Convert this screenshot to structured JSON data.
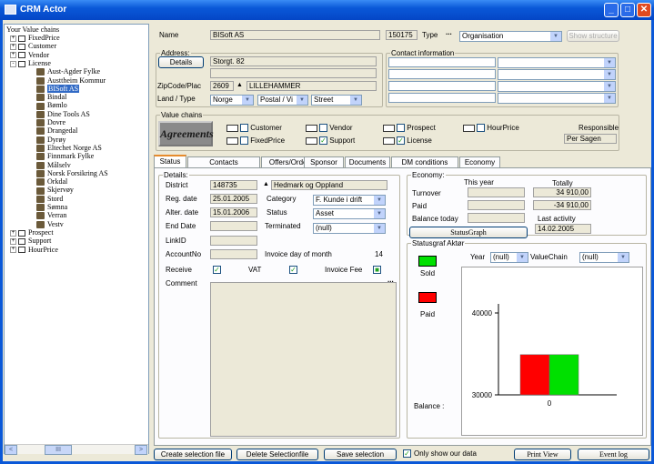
{
  "window": {
    "title": "CRM Actor",
    "minimize": "_",
    "maximize": "□",
    "close": "✕"
  },
  "tree": {
    "header": "Your Value chains",
    "items": [
      {
        "label": "FixedPrice",
        "type": "folder",
        "expand": "+"
      },
      {
        "label": "Customer",
        "type": "folder",
        "expand": "+"
      },
      {
        "label": "Vendor",
        "type": "folder",
        "expand": "+"
      },
      {
        "label": "License",
        "type": "folder",
        "expand": "-"
      },
      {
        "label": "Aust-Agder Fylke",
        "type": "leaf"
      },
      {
        "label": "Austtheim Kommur",
        "type": "leaf"
      },
      {
        "label": "BISoft AS",
        "type": "leaf",
        "selected": true
      },
      {
        "label": "Bindal",
        "type": "leaf"
      },
      {
        "label": "Bømlo",
        "type": "leaf"
      },
      {
        "label": "Dine Tools AS",
        "type": "leaf"
      },
      {
        "label": "Dovre",
        "type": "leaf"
      },
      {
        "label": "Drangedal",
        "type": "leaf"
      },
      {
        "label": "Dyrøy",
        "type": "leaf"
      },
      {
        "label": "Eltechet Norge AS",
        "type": "leaf"
      },
      {
        "label": "Finnmark Fylke",
        "type": "leaf"
      },
      {
        "label": "Målselv",
        "type": "leaf"
      },
      {
        "label": "Norsk Forsikring AS",
        "type": "leaf"
      },
      {
        "label": "Orkdal",
        "type": "leaf"
      },
      {
        "label": "Skjervøy",
        "type": "leaf"
      },
      {
        "label": "Stord",
        "type": "leaf"
      },
      {
        "label": "Sømna",
        "type": "leaf"
      },
      {
        "label": "Verran",
        "type": "leaf"
      },
      {
        "label": "Vestv",
        "type": "leaf"
      },
      {
        "label": "Prospect",
        "type": "folder",
        "expand": "+"
      },
      {
        "label": "Support",
        "type": "folder",
        "expand": "+"
      },
      {
        "label": "HourPrice",
        "type": "folder",
        "expand": "+"
      }
    ],
    "scroll_left": "<",
    "scroll_mid": "III",
    "scroll_right": ">"
  },
  "header": {
    "name_label": "Name",
    "name_value": "BISoft AS",
    "id_value": "150175",
    "type_label": "Type",
    "type_btn": "...",
    "type_value": "Organisation",
    "show_structure": "Show structure"
  },
  "address": {
    "title": "Address:",
    "details_btn": "Details",
    "street": "Storgt. 82",
    "line2": "",
    "zip_label": "ZipCode/Plac",
    "zip": "2609",
    "zip_btn": "▲",
    "city": "LILLEHAMMER",
    "land_label": "Land / Type",
    "land": "Norge",
    "postal": "Postal / Vi",
    "street_type": "Street"
  },
  "contact": {
    "title": "Contact information"
  },
  "value_chains": {
    "title": "Value chains",
    "logo": "Agreements",
    "items": [
      {
        "label": "Customer",
        "checked": false
      },
      {
        "label": "Vendor",
        "checked": false
      },
      {
        "label": "Prospect",
        "checked": false
      },
      {
        "label": "HourPrice",
        "checked": false
      },
      {
        "label": "FixedPrice",
        "checked": false
      },
      {
        "label": "Support",
        "checked": true
      },
      {
        "label": "License",
        "checked": true
      }
    ],
    "responsible_label": "Responsible",
    "responsible_value": "Per Sagen"
  },
  "tabs": [
    "Status",
    "Contacts",
    "Offers/Orders",
    "Sponsor",
    "Documents",
    "DM conditions",
    "Economy"
  ],
  "details": {
    "title": "Details:",
    "district_label": "District",
    "district_code": "148735",
    "district_btn": "▲",
    "district_name": "Hedmark og Oppland",
    "reg_label": "Reg. date",
    "reg_date": "25.01.2005",
    "category_label": "Category",
    "category": "F. Kunde i drift",
    "alter_label": "Alter. date",
    "alter_date": "15.01.2006",
    "status_label": "Status",
    "status": "Asset",
    "end_label": "End Date",
    "terminated_label": "Terminated",
    "terminated": "(null)",
    "linkid_label": "LinkID",
    "account_label": "AccountNo",
    "invoice_day_label": "Invoice day of month",
    "invoice_day": "14",
    "receive_label": "Receive",
    "vat_label": "VAT",
    "invoice_fee_label": "Invoice Fee",
    "comment_label": "Comment",
    "comment_btn": "..."
  },
  "economy": {
    "title": "Economy:",
    "this_year": "This year",
    "totally": "Totally",
    "turnover_label": "Turnover",
    "paid_label": "Paid",
    "balance_label": "Balance today",
    "turnover_total": "34 910,00",
    "paid_total": "-34 910,00",
    "last_activity_label": "Last activity",
    "last_activity": "14.02.2005",
    "status_graph_btn": "StatusGraph"
  },
  "graph": {
    "title": "Statusgraf Aktør",
    "year_label": "Year",
    "year_value": "(null)",
    "vc_label": "ValueChain",
    "vc_value": "(null)",
    "sold_label": "Sold",
    "paid_label": "Paid",
    "balance_label": "Balance :",
    "colors": {
      "sold": "#00e000",
      "paid": "#ff0000"
    }
  },
  "chart_data": {
    "type": "bar",
    "categories": [
      "0"
    ],
    "series": [
      {
        "name": "Paid",
        "values": [
          34910
        ]
      },
      {
        "name": "Sold",
        "values": [
          34910
        ]
      }
    ],
    "ylim": [
      30000,
      40000
    ],
    "yticks": [
      "30000",
      "40000"
    ],
    "xticks": [
      "0"
    ]
  },
  "footer": {
    "create_btn": "Create selection file",
    "delete_btn": "Delete Selectionfile",
    "save_btn": "Save selection",
    "only_ours": "Only show our data",
    "print_btn": "Print View",
    "log_btn": "Event log"
  }
}
